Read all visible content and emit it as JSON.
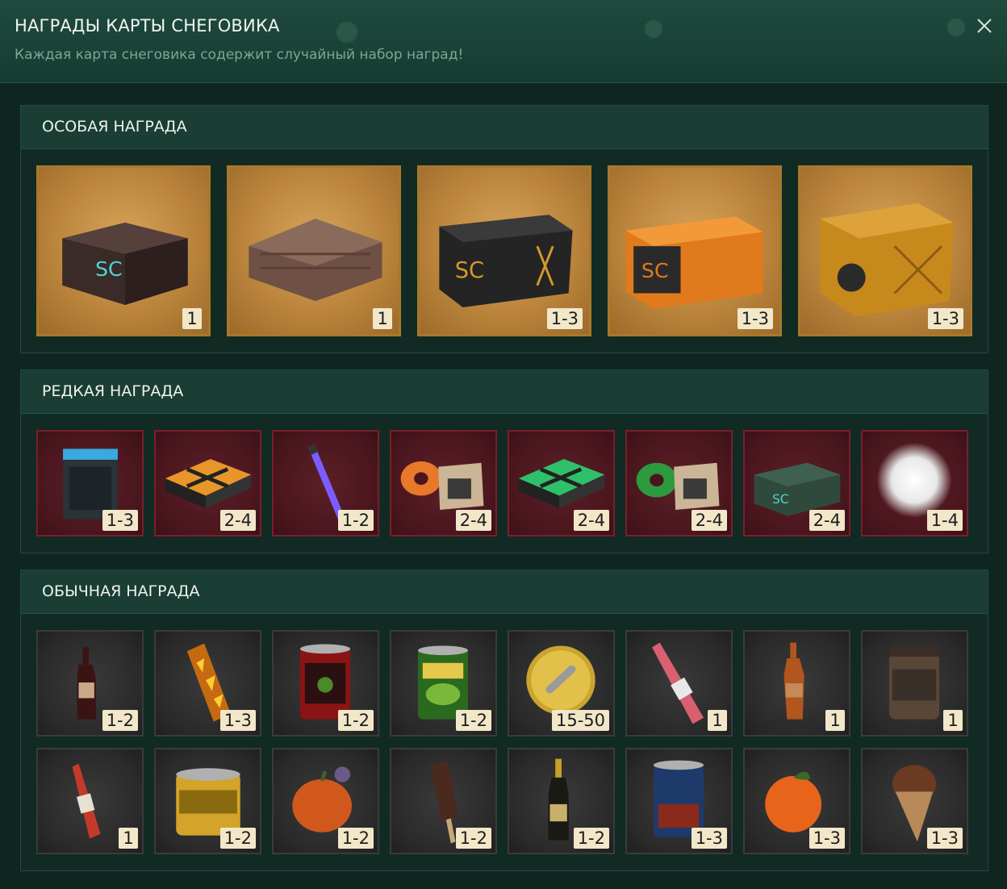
{
  "header": {
    "title": "НАГРАДЫ КАРТЫ СНЕГОВИКА",
    "subtitle": "Каждая карта снеговика содержит случайный набор наград!"
  },
  "sections": [
    {
      "title": "ОСОБАЯ НАГРАДА",
      "items": [
        {
          "icon": "sc-dark-crate-icon",
          "qty": "1"
        },
        {
          "icon": "wooden-crate-icon",
          "qty": "1"
        },
        {
          "icon": "black-sc-box-icon",
          "qty": "1-3"
        },
        {
          "icon": "orange-sc-box-icon",
          "qty": "1-3"
        },
        {
          "icon": "yellow-cube-crate-icon",
          "qty": "1-3"
        }
      ]
    },
    {
      "title": "РЕДКАЯ НАГРАДА",
      "items": [
        {
          "icon": "battery-box-icon",
          "qty": "1-3"
        },
        {
          "icon": "orange-x-case-icon",
          "qty": "2-4"
        },
        {
          "icon": "purple-glowstick-icon",
          "qty": "1-2"
        },
        {
          "icon": "orange-tape-kit-icon",
          "qty": "2-4"
        },
        {
          "icon": "green-x-case-icon",
          "qty": "2-4"
        },
        {
          "icon": "green-tape-kit-icon",
          "qty": "2-4"
        },
        {
          "icon": "military-crate-icon",
          "qty": "2-4"
        },
        {
          "icon": "snowball-icon",
          "qty": "1-4"
        }
      ]
    },
    {
      "title": "ОБЫЧНАЯ НАГРАДА",
      "items": [
        {
          "icon": "wine-bottle-icon",
          "qty": "1-2"
        },
        {
          "icon": "firework-candle-icon",
          "qty": "1-3"
        },
        {
          "icon": "bean-can-icon",
          "qty": "1-2"
        },
        {
          "icon": "peas-can-icon",
          "qty": "1-2"
        },
        {
          "icon": "gold-coin-icon",
          "qty": "15-50"
        },
        {
          "icon": "ketchup-bottle-icon",
          "qty": "1"
        },
        {
          "icon": "brown-bottle-icon",
          "qty": "1"
        },
        {
          "icon": "stark-jar-icon",
          "qty": "1"
        },
        {
          "icon": "red-bottle-icon",
          "qty": "1"
        },
        {
          "icon": "corn-can-icon",
          "qty": "1-2"
        },
        {
          "icon": "pumpkin-icon",
          "qty": "1-2"
        },
        {
          "icon": "ice-cream-bar-icon",
          "qty": "1-2"
        },
        {
          "icon": "champagne-icon",
          "qty": "1-2"
        },
        {
          "icon": "beans-can-icon",
          "qty": "1-3"
        },
        {
          "icon": "tangerine-icon",
          "qty": "1-3"
        },
        {
          "icon": "ice-cream-cone-icon",
          "qty": "1-3"
        }
      ]
    }
  ]
}
